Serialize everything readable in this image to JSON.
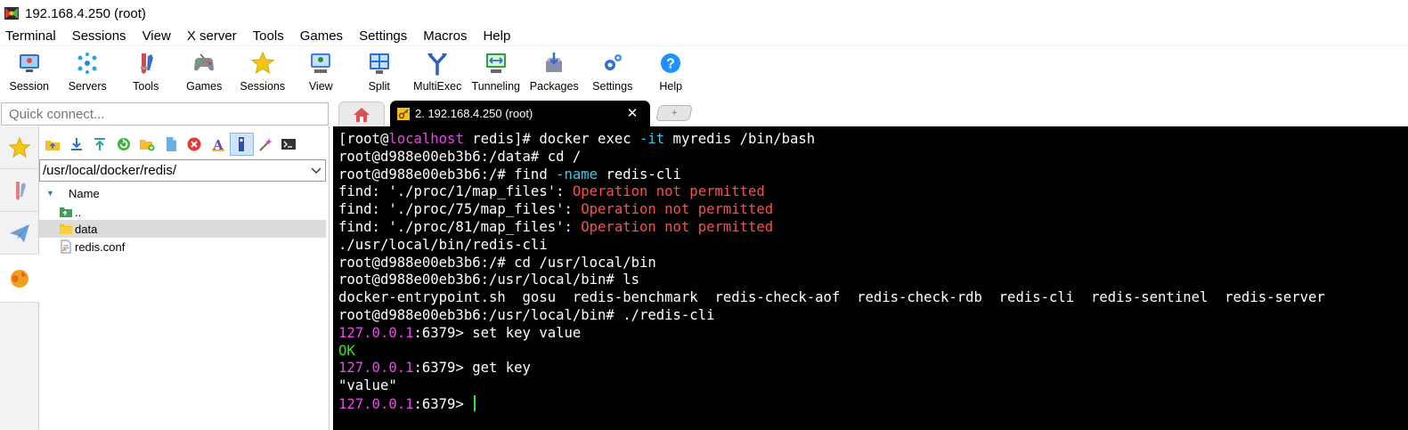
{
  "window": {
    "title": "192.168.4.250 (root)"
  },
  "menu": [
    "Terminal",
    "Sessions",
    "View",
    "X server",
    "Tools",
    "Games",
    "Settings",
    "Macros",
    "Help"
  ],
  "toolbar": [
    {
      "label": "Session",
      "icon": "session-icon"
    },
    {
      "label": "Servers",
      "icon": "servers-icon"
    },
    {
      "label": "Tools",
      "icon": "tools-icon"
    },
    {
      "label": "Games",
      "icon": "games-icon"
    },
    {
      "label": "Sessions",
      "icon": "star-icon"
    },
    {
      "label": "View",
      "icon": "view-icon"
    },
    {
      "label": "Split",
      "icon": "split-icon"
    },
    {
      "label": "MultiExec",
      "icon": "multiexec-icon"
    },
    {
      "label": "Tunneling",
      "icon": "tunneling-icon"
    },
    {
      "label": "Packages",
      "icon": "packages-icon"
    },
    {
      "label": "Settings",
      "icon": "settings-icon"
    },
    {
      "label": "Help",
      "icon": "help-icon"
    }
  ],
  "quick_connect": {
    "placeholder": "Quick connect..."
  },
  "tabs": {
    "home_icon": "home-icon",
    "active_label": "2. 192.168.4.250 (root)",
    "close_glyph": "✕"
  },
  "file_browser": {
    "path": "/usr/local/docker/redis/",
    "column_header": "Name",
    "items": [
      {
        "name": "..",
        "type": "parent-folder",
        "selected": false
      },
      {
        "name": "data",
        "type": "folder",
        "selected": true
      },
      {
        "name": "redis.conf",
        "type": "file",
        "selected": false
      }
    ]
  },
  "terminal": {
    "lines": [
      [
        {
          "t": "[root@"
        },
        {
          "t": "localhost",
          "c": "magenta"
        },
        {
          "t": " redis]# docker exec "
        },
        {
          "t": "-it",
          "c": "cyan"
        },
        {
          "t": " myredis /bin/bash"
        }
      ],
      [
        {
          "t": "root@d988e00eb3b6:/data# cd /"
        }
      ],
      [
        {
          "t": "root@d988e00eb3b6:/# find "
        },
        {
          "t": "-name",
          "c": "cyan"
        },
        {
          "t": " redis-cli"
        }
      ],
      [
        {
          "t": "find: './proc/1/map_files': "
        },
        {
          "t": "Operation not permitted",
          "c": "red"
        }
      ],
      [
        {
          "t": "find: './proc/75/map_files': "
        },
        {
          "t": "Operation not permitted",
          "c": "red"
        }
      ],
      [
        {
          "t": "find: './proc/81/map_files': "
        },
        {
          "t": "Operation not permitted",
          "c": "red"
        }
      ],
      [
        {
          "t": "./usr/local/bin/redis-cli"
        }
      ],
      [
        {
          "t": "root@d988e00eb3b6:/# cd /usr/local/bin"
        }
      ],
      [
        {
          "t": "root@d988e00eb3b6:/usr/local/bin# ls"
        }
      ],
      [
        {
          "t": "docker-entrypoint.sh  gosu  redis-benchmark  redis-check-aof  redis-check-rdb  redis-cli  redis-sentinel  redis-server"
        }
      ],
      [
        {
          "t": "root@d988e00eb3b6:/usr/local/bin# ./redis-cli"
        }
      ],
      [
        {
          "t": "127.0.0.1",
          "c": "magenta"
        },
        {
          "t": ":6379> set key value"
        }
      ],
      [
        {
          "t": "OK",
          "c": "green"
        }
      ],
      [
        {
          "t": "127.0.0.1",
          "c": "magenta"
        },
        {
          "t": ":6379> get key"
        }
      ],
      [
        {
          "t": "\"value\""
        }
      ],
      [
        {
          "t": "127.0.0.1",
          "c": "magenta"
        },
        {
          "t": ":6379> "
        }
      ]
    ]
  },
  "colors": {
    "terminal_bg": "#000000",
    "prompt_host": "#e848e8",
    "option_flag": "#3cc8e8",
    "error": "#ff4d4d",
    "ok": "#2ee62e"
  }
}
